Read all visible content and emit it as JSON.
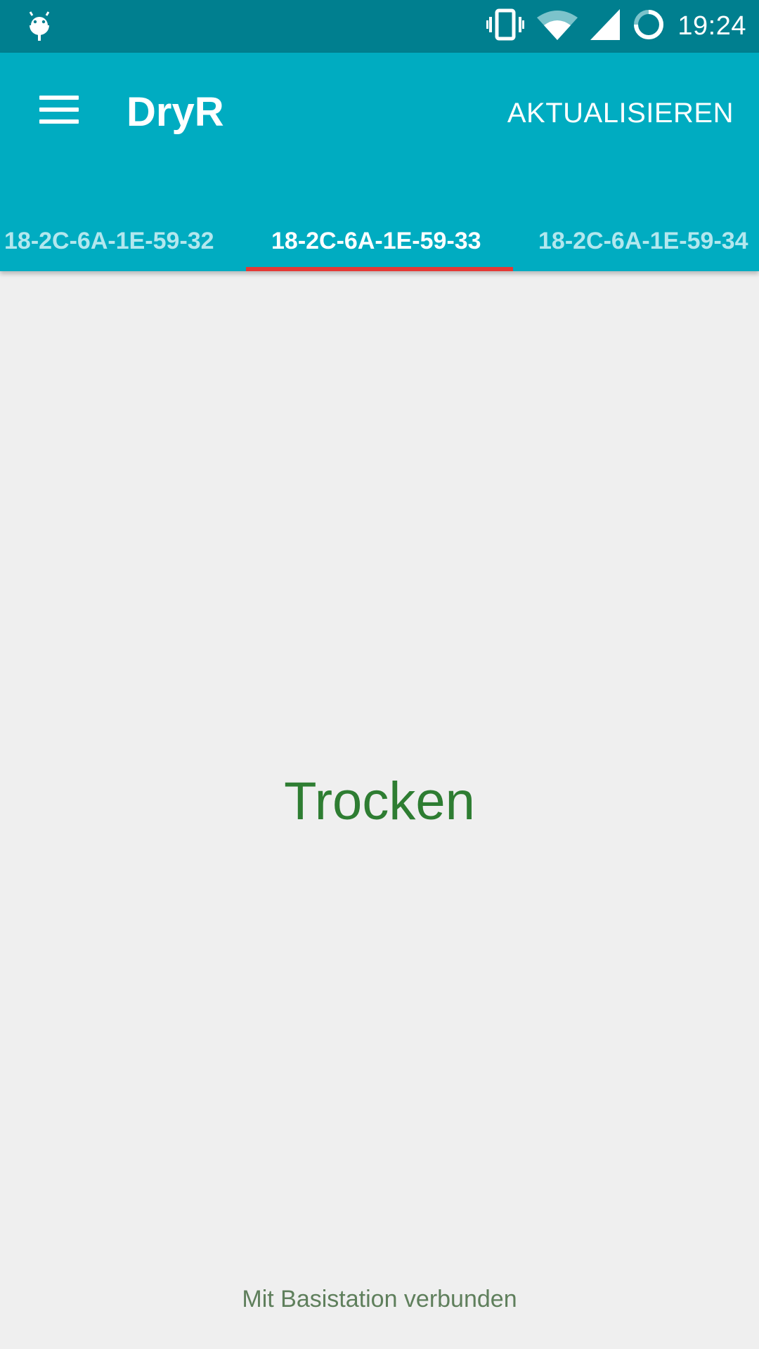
{
  "status_bar": {
    "time": "19:24",
    "icons": [
      "android-debug-icon",
      "vibrate-icon",
      "wifi-icon",
      "cell-signal-icon",
      "sync-ring-icon"
    ]
  },
  "app_bar": {
    "title": "DryR",
    "menu_icon": "hamburger-menu-icon",
    "action_label": "AKTUALISIEREN",
    "color": "#00acc1"
  },
  "tabs": [
    {
      "label": "18-2C-6A-1E-59-32",
      "selected": false
    },
    {
      "label": "18-2C-6A-1E-59-33",
      "selected": true
    },
    {
      "label": "18-2C-6A-1E-59-34",
      "selected": false
    }
  ],
  "main": {
    "state_text": "Trocken",
    "state_color": "#2e7d32",
    "connection_text": "Mit Basistation verbunden"
  },
  "colors": {
    "status_bar": "#007f8f",
    "tab_indicator": "#e53935",
    "background": "#efefef"
  }
}
